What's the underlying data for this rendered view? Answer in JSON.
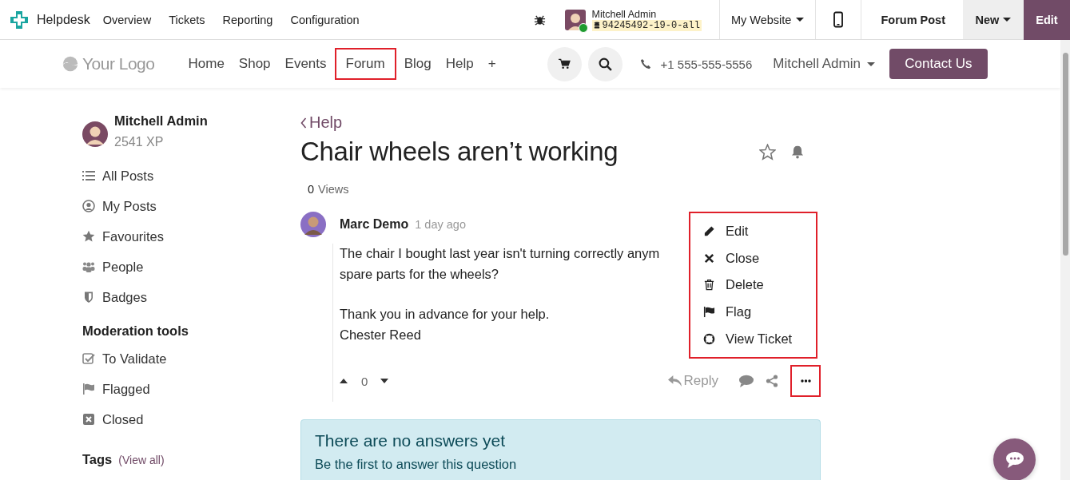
{
  "topbar": {
    "app": "Helpdesk",
    "menu": [
      "Overview",
      "Tickets",
      "Reporting",
      "Configuration"
    ],
    "user": "Mitchell Admin",
    "database": "94245492-19-0-all",
    "website": "My Website",
    "record": "Forum Post",
    "new": "New",
    "edit": "Edit"
  },
  "site_header": {
    "logo": "Your Logo",
    "nav": [
      {
        "label": "Home",
        "highlighted": false
      },
      {
        "label": "Shop",
        "highlighted": false
      },
      {
        "label": "Events",
        "highlighted": false
      },
      {
        "label": "Forum",
        "highlighted": true
      },
      {
        "label": "Blog",
        "highlighted": false
      },
      {
        "label": "Help",
        "highlighted": false
      },
      {
        "label": "+",
        "highlighted": false
      }
    ],
    "phone": "+1 555-555-5556",
    "account": "Mitchell Admin",
    "contact": "Contact Us"
  },
  "sidebar": {
    "user": "Mitchell Admin",
    "xp": "2541 XP",
    "items": [
      "All Posts",
      "My Posts",
      "Favourites",
      "People",
      "Badges"
    ],
    "moderation_title": "Moderation tools",
    "moderation": [
      "To Validate",
      "Flagged",
      "Closed"
    ],
    "tags_title": "Tags",
    "tags_link": "(View all)"
  },
  "post": {
    "back": "Help",
    "title": "Chair wheels aren’t working",
    "views_count": "0",
    "views_label": "Views",
    "author": "Marc Demo",
    "time": "1 day ago",
    "paragraphs": [
      [
        "The chair I bought last year isn't turning correctly anym",
        "spare parts for the wheels?"
      ],
      [
        "Thank you in advance for your help.",
        "Chester Reed"
      ]
    ],
    "votes": "0",
    "reply": "Reply",
    "more_highlighted": true
  },
  "menu": {
    "highlighted": true,
    "items": [
      "Edit",
      "Close",
      "Delete",
      "Flag",
      "View Ticket"
    ]
  },
  "answers": {
    "title": "There are no answers yet",
    "text": "Be the first to answer this question"
  }
}
